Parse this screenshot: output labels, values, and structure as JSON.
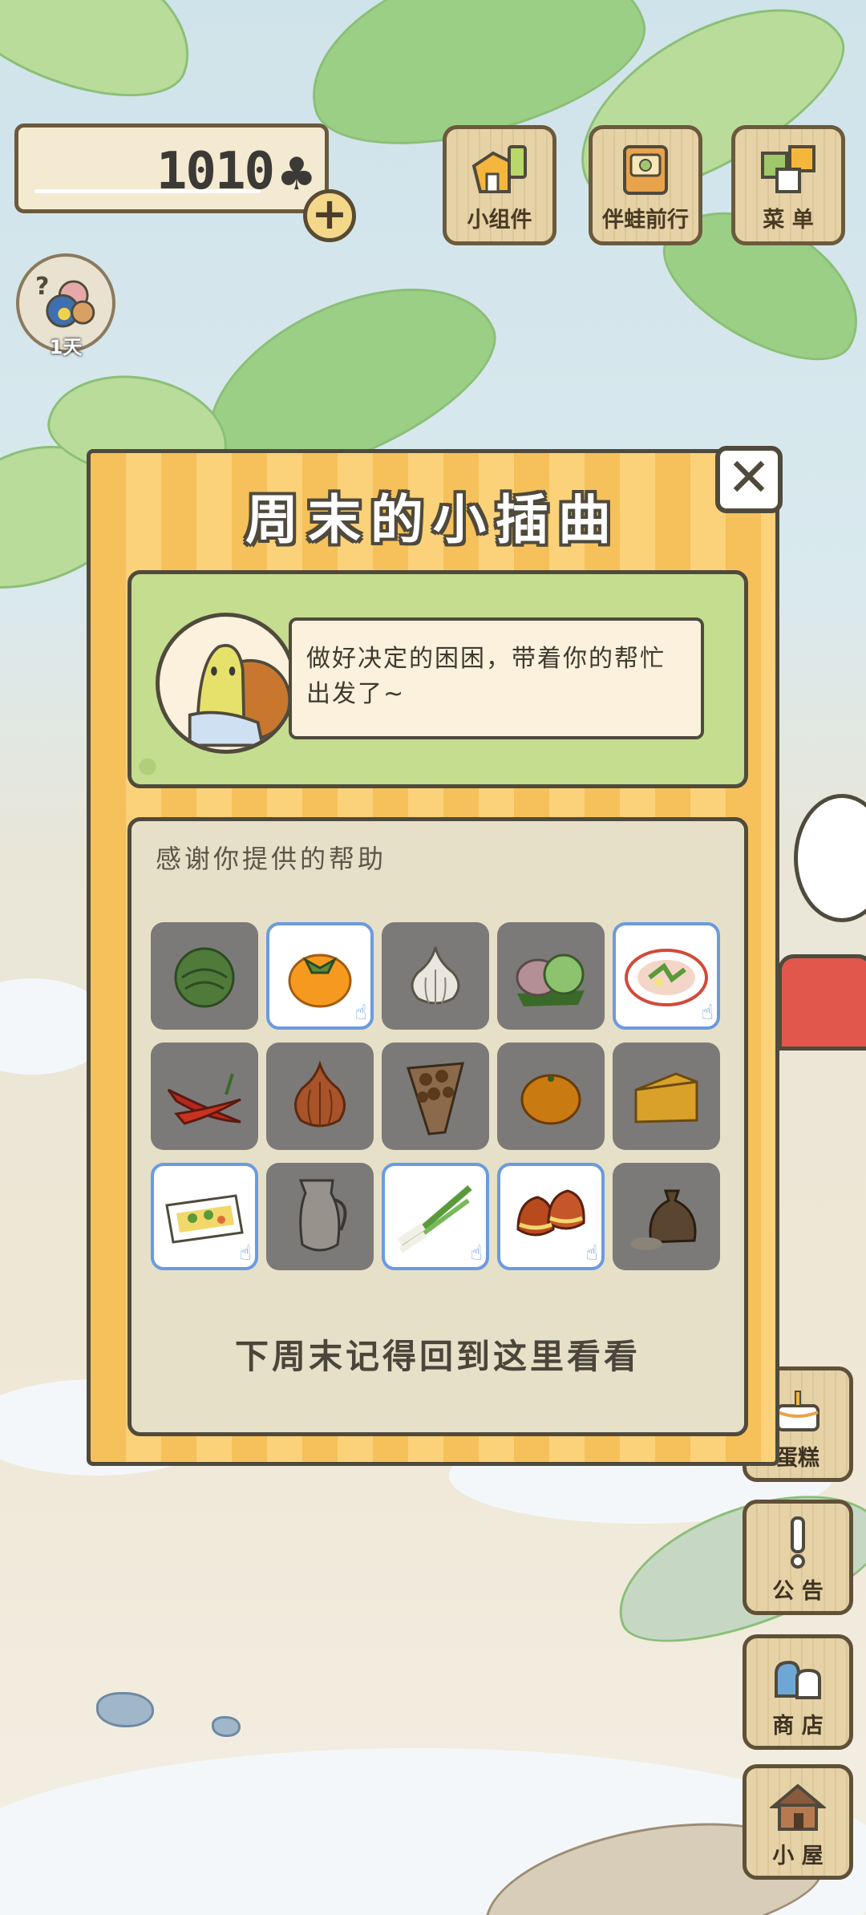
{
  "hud": {
    "clover_count": "1010",
    "clover_icon": "♣",
    "plus_label": "+",
    "buttons": [
      {
        "label": "小组件",
        "icon": "widget-icon"
      },
      {
        "label": "伴蛙前行",
        "icon": "frog-journey-icon"
      },
      {
        "label": "菜 单",
        "icon": "menu-icon"
      }
    ],
    "avatar_question": "?",
    "avatar_days": "1天"
  },
  "side": {
    "cake_label": "蛋糕",
    "notice_label": "公 告",
    "shop_label": "商 店",
    "house_label": "小 屋"
  },
  "modal": {
    "title": "周末的小插曲",
    "close_label": "✕",
    "story_text": "做好决定的困困，带着你的帮忙出发了~",
    "gift_heading": "感谢你提供的帮助",
    "footer": "下周末记得回到这里看看",
    "items": [
      {
        "name": "cabbage",
        "owned": false
      },
      {
        "name": "persimmon",
        "owned": true
      },
      {
        "name": "garlic",
        "owned": false
      },
      {
        "name": "mochi",
        "owned": false
      },
      {
        "name": "salad-plate",
        "owned": true
      },
      {
        "name": "chili-peppers",
        "owned": false
      },
      {
        "name": "onion",
        "owned": false
      },
      {
        "name": "chestnut-bag",
        "owned": false
      },
      {
        "name": "orange",
        "owned": false
      },
      {
        "name": "cheese",
        "owned": false
      },
      {
        "name": "bento-box",
        "owned": true
      },
      {
        "name": "glass-pitcher",
        "owned": false
      },
      {
        "name": "green-onion",
        "owned": true
      },
      {
        "name": "chestnuts",
        "owned": true
      },
      {
        "name": "rice-sack",
        "owned": false
      }
    ]
  },
  "colors": {
    "modal_stripe": "#f6c15a",
    "story_bg": "#c5dd8f",
    "owned_border": "#6a9be0",
    "locked_cell": "#7c7a78"
  }
}
